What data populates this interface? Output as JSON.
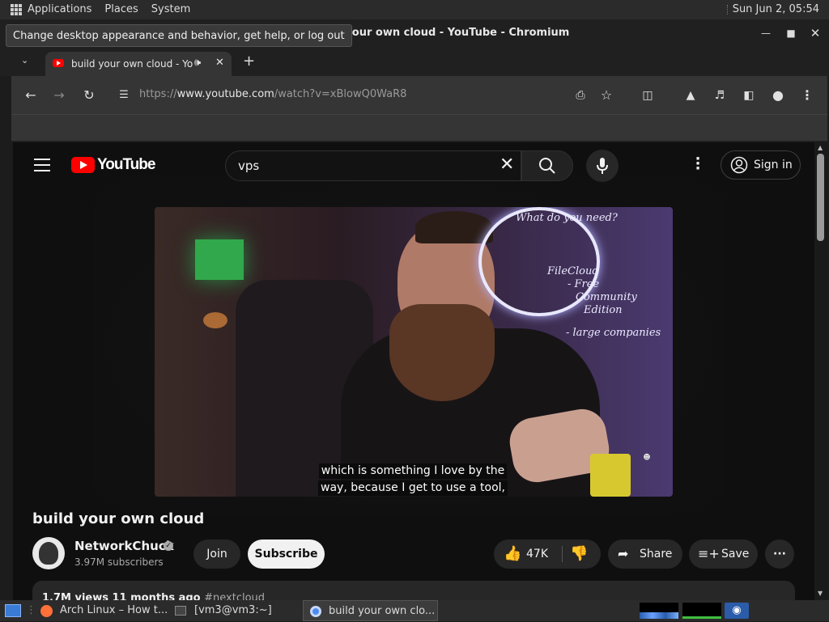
{
  "panel": {
    "applications": "Applications",
    "places": "Places",
    "system": "System",
    "clock": "Sun Jun  2, 05:54"
  },
  "tooltip": "Change desktop appearance and behavior, get help, or log out",
  "window": {
    "title": "build your own cloud - YouTube - Chromium"
  },
  "browser": {
    "tab_title": "build your own cloud - You",
    "new_tab": "+",
    "url_scheme": "https://",
    "url_host": "www.youtube.com",
    "url_path": "/watch?v=xBlowQ0WaR8"
  },
  "youtube": {
    "logo_text": "YouTube",
    "search_value": "vps",
    "signin_label": "Sign in",
    "captions": [
      "which is something I love by the",
      "way, because I get to use a tool,"
    ],
    "video_title": "build your own cloud",
    "channel_name": "NetworkChuck",
    "subscribers": "3.97M subscribers",
    "join_label": "Join",
    "subscribe_label": "Subscribe",
    "likes": "47K",
    "share_label": "Share",
    "save_label": "Save",
    "views_text": "1.7M views  11 months ago",
    "hashtag": "#nextcloud",
    "whiteboard": [
      "What do you need?",
      "FileCloud",
      "- Free",
      "Community",
      "Edition",
      "- large companies"
    ]
  },
  "taskbar": {
    "task1": "Arch Linux – How t...",
    "task2": "[vm3@vm3:~]",
    "task3": "build your own clo..."
  },
  "colors": {
    "youtube_red": "#ff0000",
    "page_bg": "#0f0f0f",
    "chrome_toolbar": "#353535"
  }
}
